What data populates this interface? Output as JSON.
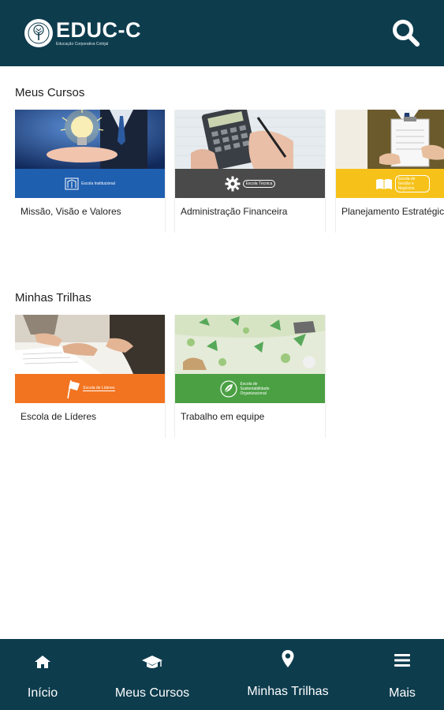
{
  "header": {
    "logo_name": "EDUC-C",
    "logo_tagline": "Educação Corporativa Cotrijal",
    "logo_icon": "tree-emblem-icon",
    "search_icon": "search-icon",
    "background": "#0d3c4d"
  },
  "sections": {
    "courses_title": "Meus Cursos",
    "trails_title": "Minhas Trilhas"
  },
  "courses": [
    {
      "title": "Missão, Visão e Valores",
      "band_text": "Escola Institucional",
      "band_color": "#1f5fb0"
    },
    {
      "title": "Administração Financeira",
      "band_text": "Escola Técnica",
      "band_color": "#4a4a4a"
    },
    {
      "title": "Planejamento Estratégico",
      "band_text": "Escola de Gestão e Negócios",
      "band_color": "#f6c21a"
    }
  ],
  "trails": [
    {
      "title": "Escola de Líderes",
      "band_text": "Escola de Líderes",
      "band_color": "#f27420"
    },
    {
      "title": "Trabalho em equipe",
      "band_text": "Escola de Sustentabilidade Organizacional",
      "band_color": "#4aa043"
    }
  ],
  "bottom_nav": [
    {
      "label": "Início",
      "icon": "home-icon"
    },
    {
      "label": "Meus Cursos",
      "icon": "graduation-cap-icon"
    },
    {
      "label": "Minhas Trilhas",
      "icon": "map-pin-icon"
    },
    {
      "label": "Mais",
      "icon": "menu-icon"
    }
  ]
}
